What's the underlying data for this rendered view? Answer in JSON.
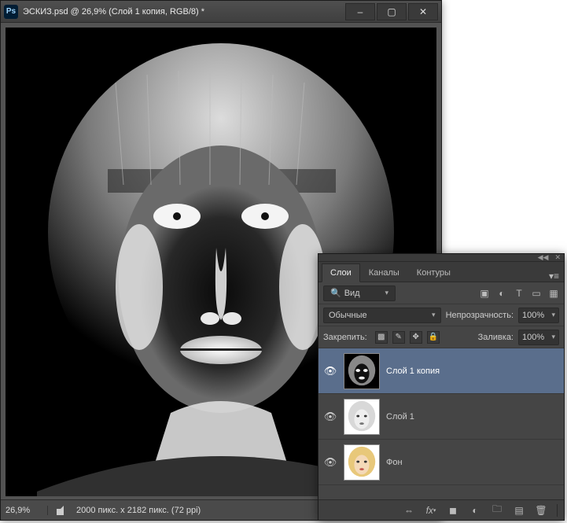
{
  "window": {
    "title": "ЭСКИЗ.psd @ 26,9% (Слой 1 копия, RGB/8) *",
    "minimize_label": "–",
    "maximize_label": "▢",
    "close_label": "✕"
  },
  "status": {
    "zoom": "26,9%",
    "doc_info": "2000 пикс. x 2182 пикс. (72 ppi)"
  },
  "panel": {
    "tabs": [
      {
        "label": "Слои",
        "active": true
      },
      {
        "label": "Каналы",
        "active": false
      },
      {
        "label": "Контуры",
        "active": false
      }
    ],
    "filter": {
      "mode": "Вид"
    },
    "blend_mode": "Обычные",
    "opacity_label": "Непрозрачность:",
    "opacity_value": "100%",
    "lock_label": "Закрепить:",
    "fill_label": "Заливка:",
    "fill_value": "100%",
    "layers": [
      {
        "name": "Слой 1 копия",
        "visible": true,
        "active": true,
        "thumb": "neg"
      },
      {
        "name": "Слой 1",
        "visible": true,
        "active": false,
        "thumb": "bw"
      },
      {
        "name": "Фон",
        "visible": true,
        "active": false,
        "thumb": "color"
      }
    ]
  }
}
